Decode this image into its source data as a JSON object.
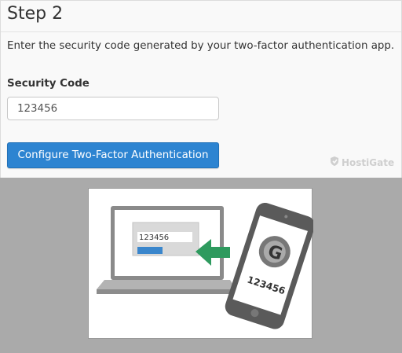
{
  "step": {
    "title": "Step 2"
  },
  "instruction": "Enter the security code generated by your two-factor authentication app.",
  "security_code": {
    "label": "Security Code",
    "value": "123456"
  },
  "configure_button": {
    "label": "Configure Two-Factor Authentication"
  },
  "watermark": {
    "brand": "HostiGate"
  },
  "illustration": {
    "laptop_code": "123456",
    "phone_code": "123456",
    "phone_logo_letter": "G",
    "arrow_color": "#2e9a5e",
    "accent_blue": "#2d84d1"
  }
}
